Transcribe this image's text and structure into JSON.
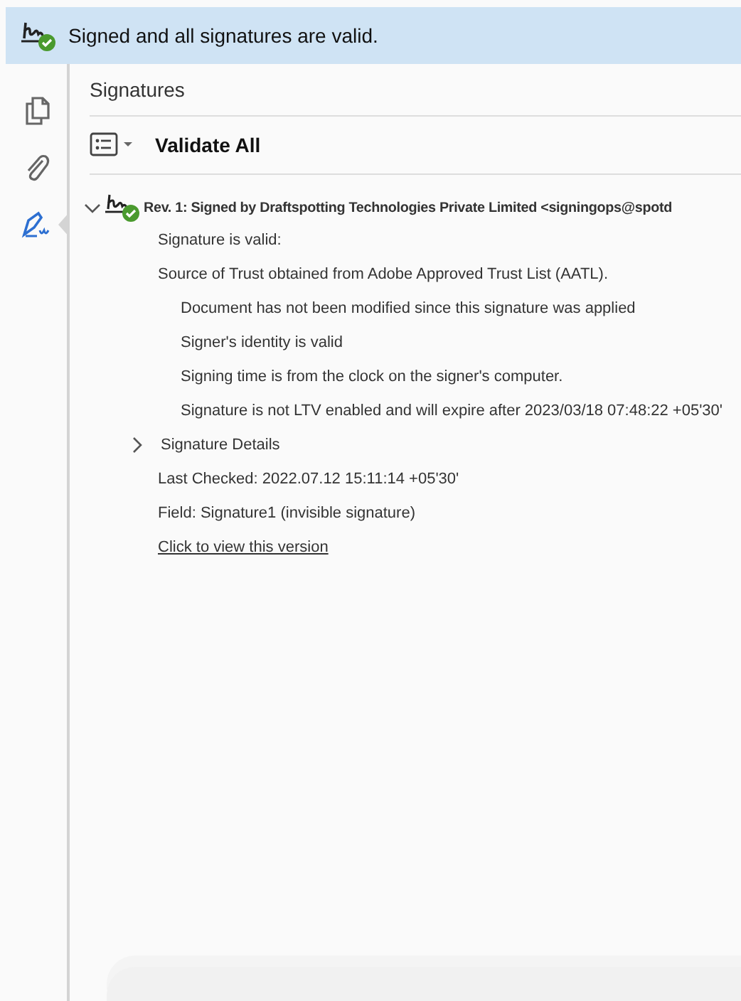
{
  "banner": {
    "text": "Signed and all signatures are valid."
  },
  "sidebar": {
    "items": [
      {
        "kind": "pages",
        "selected": false
      },
      {
        "kind": "attachment",
        "selected": false
      },
      {
        "kind": "signature",
        "selected": true
      }
    ]
  },
  "panel": {
    "title": "Signatures",
    "toolbar": {
      "button": "Validate All"
    }
  },
  "revision": {
    "title": "Rev. 1: Signed by Draftspotting Technologies Private Limited <signingops@spotd",
    "expanded": true,
    "status": [
      {
        "text": "Signature is valid:"
      },
      {
        "text": "Source of Trust obtained from Adobe Approved Trust List (AATL).",
        "children": [
          {
            "text": "Document has not been modified since this signature was applied"
          },
          {
            "text": "Signer's identity is valid"
          },
          {
            "text": "Signing time is from the clock on the signer's computer."
          },
          {
            "text": "Signature is not LTV enabled and will expire after 2023/03/18 07:48:22 +05'30'"
          }
        ]
      }
    ],
    "details": {
      "label": "Signature Details",
      "expanded": false
    },
    "last_checked": "Last Checked: 2022.07.12 15:11:14 +05'30'",
    "field": "Field: Signature1 (invisible signature)",
    "link": "Click to view this version"
  }
}
